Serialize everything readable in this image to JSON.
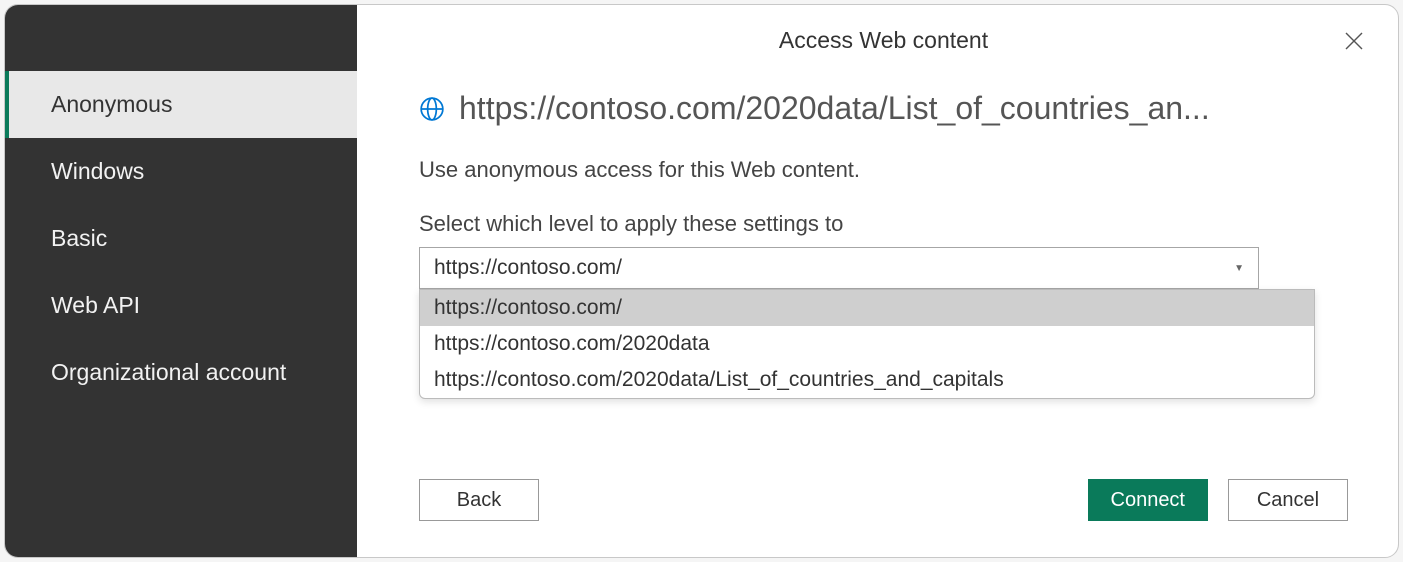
{
  "dialog": {
    "title": "Access Web content"
  },
  "sidebar": {
    "items": [
      {
        "label": "Anonymous",
        "active": true
      },
      {
        "label": "Windows",
        "active": false
      },
      {
        "label": "Basic",
        "active": false
      },
      {
        "label": "Web API",
        "active": false
      },
      {
        "label": "Organizational account",
        "active": false
      }
    ]
  },
  "main": {
    "url_display": "https://contoso.com/2020data/List_of_countries_an...",
    "instruction": "Use anonymous access for this Web content.",
    "select_label": "Select which level to apply these settings to",
    "select_value": "https://contoso.com/",
    "dropdown_options": [
      "https://contoso.com/",
      "https://contoso.com/2020data",
      "https://contoso.com/2020data/List_of_countries_and_capitals"
    ]
  },
  "buttons": {
    "back": "Back",
    "connect": "Connect",
    "cancel": "Cancel"
  }
}
